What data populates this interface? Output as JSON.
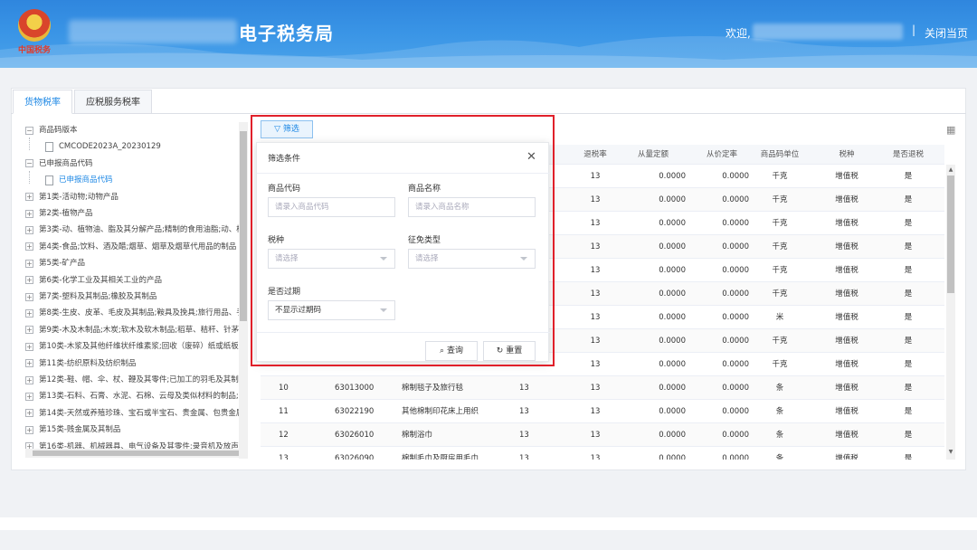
{
  "header": {
    "site_title": "电子税务局",
    "emblem_text": "中国税务",
    "welcome": "欢迎,",
    "separator": "|",
    "close_label": "关闭当页"
  },
  "tabs": [
    {
      "label": "货物税率",
      "active": true
    },
    {
      "label": "应税服务税率",
      "active": false
    }
  ],
  "tree": {
    "items": [
      {
        "label": "商品码版本",
        "toggle": "−",
        "indent": 0
      },
      {
        "label": "CMCODE2023A_20230129",
        "toggle": "file",
        "indent": 1
      },
      {
        "label": "已申报商品代码",
        "toggle": "−",
        "indent": 0
      },
      {
        "label": "已申报商品代码",
        "toggle": "file",
        "indent": 1,
        "selected": true
      },
      {
        "label": "第1类-活动物;动物产品",
        "toggle": "+",
        "indent": 0
      },
      {
        "label": "第2类-植物产品",
        "toggle": "+",
        "indent": 0
      },
      {
        "label": "第3类-动、植物油、脂及其分解产品;精制的食用油脂;动、植",
        "toggle": "+",
        "indent": 0
      },
      {
        "label": "第4类-食品;饮料、酒及醋;烟草、烟草及烟草代用品的制品",
        "toggle": "+",
        "indent": 0
      },
      {
        "label": "第5类-矿产品",
        "toggle": "+",
        "indent": 0
      },
      {
        "label": "第6类-化学工业及其相关工业的产品",
        "toggle": "+",
        "indent": 0
      },
      {
        "label": "第7类-塑料及其制品;橡胶及其制品",
        "toggle": "+",
        "indent": 0
      },
      {
        "label": "第8类-生皮、皮革、毛皮及其制品;鞍具及挽具;旅行用品、手",
        "toggle": "+",
        "indent": 0
      },
      {
        "label": "第9类-木及木制品;木炭;软木及软木制品;稻草、秸秆、针茅",
        "toggle": "+",
        "indent": 0
      },
      {
        "label": "第10类-木浆及其他纤维状纤维素浆;回收（废碎）纸或纸板",
        "toggle": "+",
        "indent": 0
      },
      {
        "label": "第11类-纺织原料及纺织制品",
        "toggle": "+",
        "indent": 0
      },
      {
        "label": "第12类-鞋、帽、伞、杖、鞭及其零件;已加工的羽毛及其制",
        "toggle": "+",
        "indent": 0
      },
      {
        "label": "第13类-石料、石膏、水泥、石棉、云母及类似材料的制品;",
        "toggle": "+",
        "indent": 0
      },
      {
        "label": "第14类-天然或养殖珍珠、宝石或半宝石、贵金属、包贵金属",
        "toggle": "+",
        "indent": 0
      },
      {
        "label": "第15类-贱金属及其制品",
        "toggle": "+",
        "indent": 0
      },
      {
        "label": "第16类-机器、机械器具、电气设备及其零件;录音机及放声",
        "toggle": "+",
        "indent": 0
      }
    ]
  },
  "table": {
    "headers": [
      "退税率",
      "从量定额",
      "从价定率",
      "商品码单位",
      "税种",
      "是否退税"
    ],
    "rows": [
      {
        "no": "",
        "code": "",
        "name": "",
        "rate": "",
        "refund": "13",
        "fixed": "0.0000",
        "adval": "0.0000",
        "unit": "千克",
        "tax": "增值税",
        "isrefund": "是"
      },
      {
        "no": "",
        "code": "",
        "name": "",
        "rate": "",
        "refund": "13",
        "fixed": "0.0000",
        "adval": "0.0000",
        "unit": "千克",
        "tax": "增值税",
        "isrefund": "是"
      },
      {
        "no": "",
        "code": "",
        "name": "",
        "rate": "",
        "refund": "13",
        "fixed": "0.0000",
        "adval": "0.0000",
        "unit": "千克",
        "tax": "增值税",
        "isrefund": "是"
      },
      {
        "no": "",
        "code": "",
        "name": "",
        "rate": "",
        "refund": "13",
        "fixed": "0.0000",
        "adval": "0.0000",
        "unit": "千克",
        "tax": "增值税",
        "isrefund": "是"
      },
      {
        "no": "",
        "code": "",
        "name": "",
        "rate": "",
        "refund": "13",
        "fixed": "0.0000",
        "adval": "0.0000",
        "unit": "千克",
        "tax": "增值税",
        "isrefund": "是"
      },
      {
        "no": "",
        "code": "",
        "name": "",
        "rate": "",
        "refund": "13",
        "fixed": "0.0000",
        "adval": "0.0000",
        "unit": "千克",
        "tax": "增值税",
        "isrefund": "是"
      },
      {
        "no": "",
        "code": "",
        "name": "",
        "rate": "",
        "refund": "13",
        "fixed": "0.0000",
        "adval": "0.0000",
        "unit": "米",
        "tax": "增值税",
        "isrefund": "是"
      },
      {
        "no": "",
        "code": "",
        "name": "",
        "rate": "",
        "refund": "13",
        "fixed": "0.0000",
        "adval": "0.0000",
        "unit": "千克",
        "tax": "增值税",
        "isrefund": "是"
      },
      {
        "no": "",
        "code": "",
        "name": "",
        "rate": "",
        "refund": "13",
        "fixed": "0.0000",
        "adval": "0.0000",
        "unit": "千克",
        "tax": "增值税",
        "isrefund": "是"
      },
      {
        "no": "10",
        "code": "63013000",
        "name": "棉制毯子及旅行毯",
        "rate": "13",
        "refund": "13",
        "fixed": "0.0000",
        "adval": "0.0000",
        "unit": "条",
        "tax": "增值税",
        "isrefund": "是"
      },
      {
        "no": "11",
        "code": "63022190",
        "name": "其他棉制印花床上用织",
        "rate": "13",
        "refund": "13",
        "fixed": "0.0000",
        "adval": "0.0000",
        "unit": "条",
        "tax": "增值税",
        "isrefund": "是"
      },
      {
        "no": "12",
        "code": "63026010",
        "name": "棉制浴巾",
        "rate": "13",
        "refund": "13",
        "fixed": "0.0000",
        "adval": "0.0000",
        "unit": "条",
        "tax": "增值税",
        "isrefund": "是"
      },
      {
        "no": "13",
        "code": "63026090",
        "name": "棉制毛巾及厨房用毛巾",
        "rate": "13",
        "refund": "13",
        "fixed": "0.0000",
        "adval": "0.0000",
        "unit": "条",
        "tax": "增值税",
        "isrefund": "是"
      }
    ]
  },
  "filter_button": {
    "label": "筛选",
    "icon": "filter-icon"
  },
  "popup": {
    "title": "筛选条件",
    "close": "✕",
    "fields": {
      "code_label": "商品代码",
      "code_placeholder": "请录入商品代码",
      "name_label": "商品名称",
      "name_placeholder": "请录入商品名称",
      "tax_label": "税种",
      "tax_placeholder": "请选择",
      "exempt_label": "征免类型",
      "exempt_placeholder": "请选择",
      "expired_label": "是否过期",
      "expired_value": "不显示过期码"
    },
    "query_label": "查询",
    "reset_label": "重置"
  },
  "colors": {
    "accent": "#1e88e5",
    "highlight_box": "#e0202a",
    "header_blue": "#2f86de"
  }
}
